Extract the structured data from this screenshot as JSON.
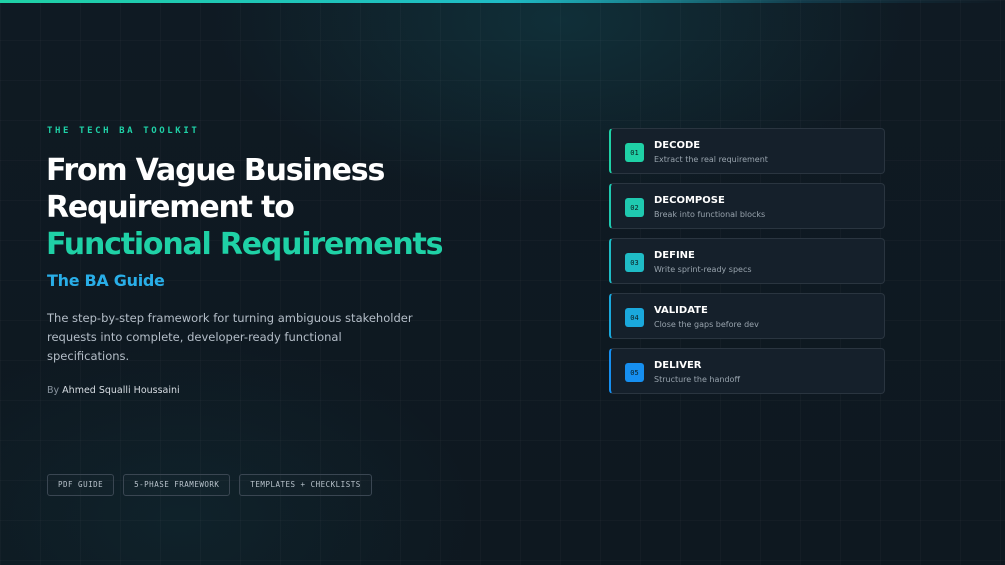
{
  "eyebrow": "THE TECH BA TOOLKIT",
  "title": {
    "line1": "From Vague Business",
    "line2": "Requirement to",
    "line3": "Functional Requirements"
  },
  "subtitle": "The BA Guide",
  "description": "The step-by-step framework for turning ambiguous stakeholder requests into complete, developer-ready functional specifications.",
  "byline": {
    "prefix": "By",
    "author": "Ahmed Squalli Houssaini"
  },
  "tags": [
    "PDF GUIDE",
    "5-PHASE FRAMEWORK",
    "TEMPLATES + CHECKLISTS"
  ],
  "steps": [
    {
      "num": "01",
      "name": "DECODE",
      "desc": "Extract the real requirement",
      "color": "#1fd1a6"
    },
    {
      "num": "02",
      "name": "DECOMPOSE",
      "desc": "Break into functional blocks",
      "color": "#1fc9b0"
    },
    {
      "num": "03",
      "name": "DEFINE",
      "desc": "Write sprint-ready specs",
      "color": "#1fbcc6"
    },
    {
      "num": "04",
      "name": "VALIDATE",
      "desc": "Close the gaps before dev",
      "color": "#1aa8dc"
    },
    {
      "num": "05",
      "name": "DELIVER",
      "desc": "Structure the handoff",
      "color": "#168ff0"
    }
  ],
  "colors": {
    "background": "#0f1a23",
    "accent_teal": "#1fd1a6",
    "accent_blue": "#29aee8",
    "card_bg": "#15202b",
    "card_border": "#2a3540"
  }
}
